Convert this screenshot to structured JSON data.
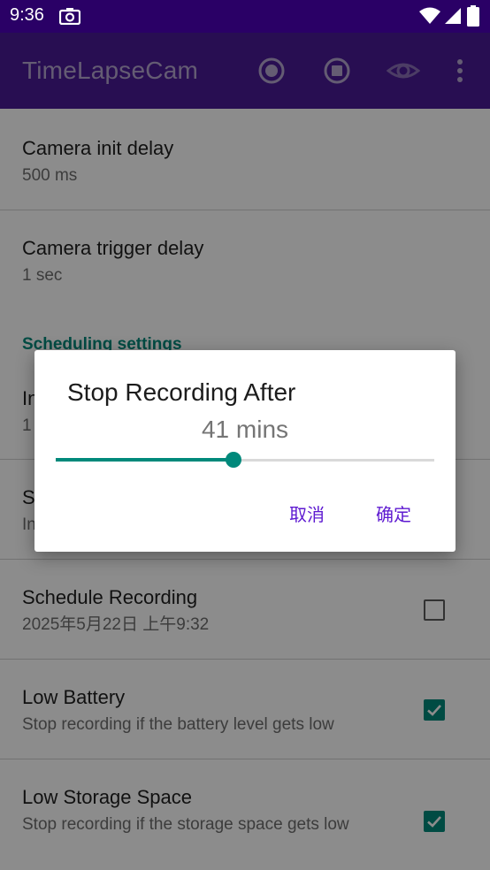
{
  "status_bar": {
    "time": "9:36"
  },
  "app_bar": {
    "title": "TimeLapseCam"
  },
  "list": {
    "camera_init_delay": {
      "title": "Camera init delay",
      "summary": "500 ms"
    },
    "camera_trigger_delay": {
      "title": "Camera trigger delay",
      "summary": "1 sec"
    },
    "section_scheduling": "Scheduling settings",
    "partial_item_1": {
      "title": "In",
      "summary": "1"
    },
    "partial_item_2": {
      "title": "S",
      "summary": "In"
    },
    "schedule_recording": {
      "title": "Schedule Recording",
      "summary": "2025年5月22日 上午9:32",
      "checked": false
    },
    "low_battery": {
      "title": "Low Battery",
      "summary": "Stop recording if the battery level gets low",
      "checked": true
    },
    "low_storage": {
      "title": "Low Storage Space",
      "summary": "Stop recording if the storage space gets low",
      "checked": true
    }
  },
  "dialog": {
    "title": "Stop Recording After",
    "value_text": "41 mins",
    "slider_fraction": 0.47,
    "cancel_label": "取消",
    "ok_label": "确定"
  },
  "colors": {
    "status_bar": "#2a0066",
    "app_bar": "#4a1b96",
    "accent": "#00897b",
    "dialog_button": "#5e1ad1"
  }
}
